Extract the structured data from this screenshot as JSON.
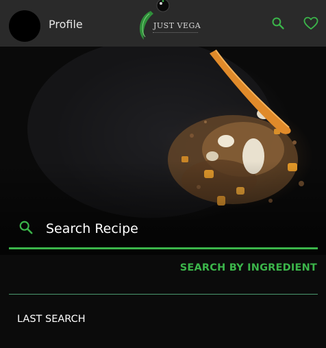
{
  "header": {
    "profile_label": "Profile",
    "logo_text": "JUST VEGA",
    "search_icon": "search-icon",
    "favorite_icon": "heart-icon"
  },
  "search": {
    "placeholder": "Search Recipe",
    "value": "",
    "ingredient_link": "SEARCH BY INGREDIENT"
  },
  "history": {
    "section_title": "LAST SEARCH"
  },
  "colors": {
    "accent": "#3bb54a",
    "app_bar": "#2a2a2a",
    "background": "#0b0b0b"
  }
}
